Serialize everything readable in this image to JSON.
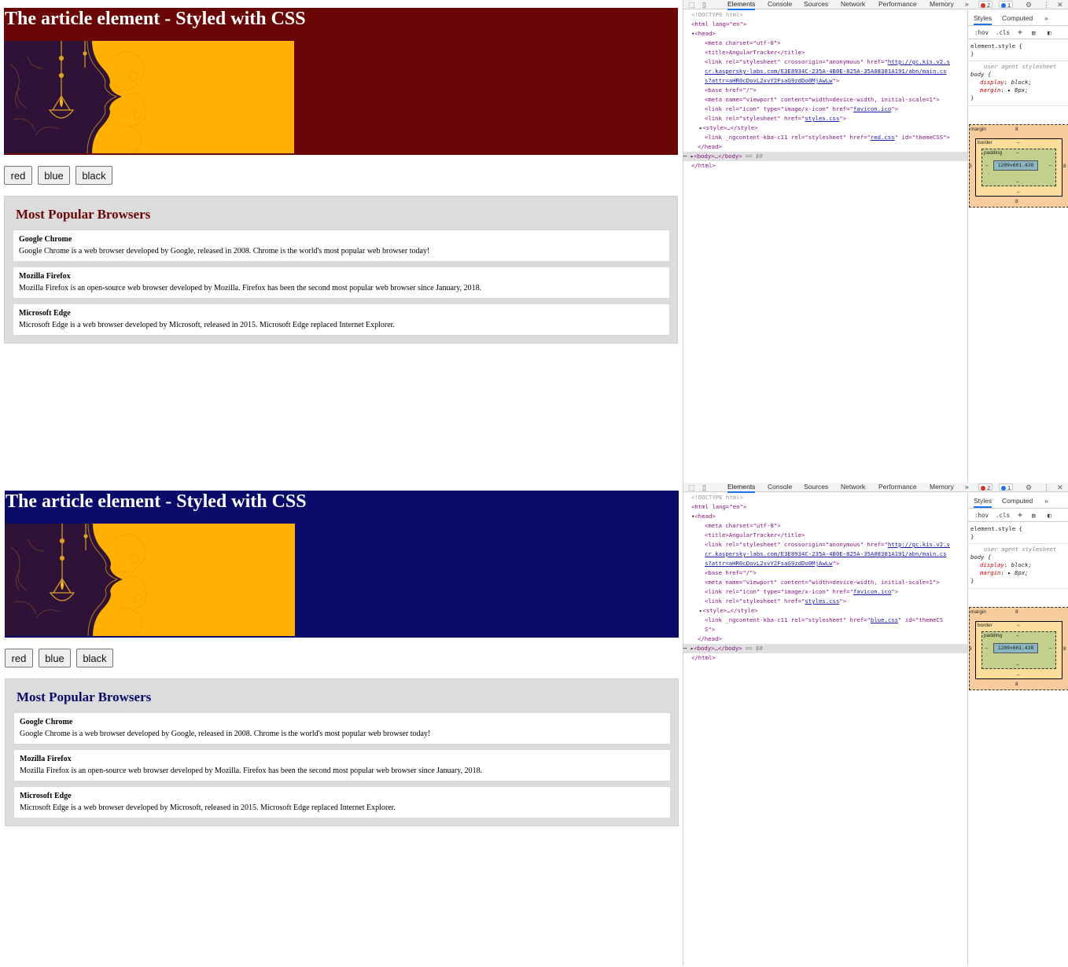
{
  "instances": [
    {
      "theme": "red",
      "banner_color": "#6b0606",
      "heading_color": "#6b0606",
      "theme_css_file": "red.css",
      "theme_css_tail": "\" id=\"themeCSS\">",
      "theme_css_tail2": ""
    },
    {
      "theme": "blue",
      "banner_color": "#0a0a6b",
      "heading_color": "#0a0a6b",
      "theme_css_file": "blue.css",
      "theme_css_tail": "\" id=\"themeCS",
      "theme_css_tail2": "S\">"
    }
  ],
  "page": {
    "title": "The article element - Styled with CSS",
    "theme_buttons": [
      "red",
      "blue",
      "black"
    ],
    "section_heading": "Most Popular Browsers",
    "browsers": [
      {
        "name": "Google Chrome",
        "description": "Google Chrome is a web browser developed by Google, released in 2008. Chrome is the world's most popular web browser today!"
      },
      {
        "name": "Mozilla Firefox",
        "description": "Mozilla Firefox is an open-source web browser developed by Mozilla. Firefox has been the second most popular web browser since January, 2018."
      },
      {
        "name": "Microsoft Edge",
        "description": "Microsoft Edge is a web browser developed by Microsoft, released in 2015. Microsoft Edge replaced Internet Explorer."
      }
    ]
  },
  "devtools": {
    "tabs": [
      "Elements",
      "Console",
      "Sources",
      "Network",
      "Performance",
      "Memory"
    ],
    "more_tabs": "»",
    "error_count": "2",
    "message_count": "1",
    "styles_tabs": [
      "Styles",
      "Computed"
    ],
    "filter_hov": ":hov",
    "filter_cls": ".cls",
    "colors": {
      "tag": "#881280",
      "attribute": "#994500",
      "value": "#1a1aa6",
      "error_dot": "#d93025",
      "message_dot": "#1a73e8",
      "margin_box": "#f9cc9d",
      "border_box": "#fddd9b",
      "padding_box": "#c3d08b",
      "content_box": "#8cb6c0"
    },
    "dom": {
      "doctype": "<!DOCTYPE html>",
      "html_open": "<html lang=\"en\">",
      "head_open": "<head>",
      "meta_charset": "<meta charset=\"utf-8\">",
      "title": "<title>AngularTracker</title>",
      "kasp_link_1": "<link rel=\"stylesheet\" crossorigin=\"anonymous\" href=\"",
      "kasp_url_1": "http://gc.kis.v2.s",
      "kasp_url_2": "cr.kaspersky-labs.com/E3E8934C-235A-4B0E-825A-35A08381A191/abn/main.cs",
      "kasp_url_3": "s?attr=aHR0cDovL2xvY2FsaG9zdDo0MjAwLw",
      "kasp_url_close": "\">",
      "base": "<base href=\"/\">",
      "meta_viewport": "<meta name=\"viewport\" content=\"width=device-width, initial-scale=1\">",
      "link_icon_pre": "<link rel=\"icon\" type=\"image/x-icon\" href=\"",
      "link_icon_href": "favicon.ico",
      "link_styles_pre": "<link rel=\"stylesheet\" href=\"",
      "link_styles_href": "styles.css",
      "link_close": "\">",
      "style_collapsed": "<style>…</style>",
      "theme_link_pre": "<link _ngcontent-kba-c11 rel=\"stylesheet\" href=\"",
      "head_close": "</head>",
      "body_collapsed": "<body>…</body>",
      "selected_marker": "== $0",
      "html_close": "</html>"
    },
    "styles": {
      "element_style": "element.style {",
      "close_brace": "}",
      "ua_label": "user agent stylesheet",
      "body_selector": "body {",
      "display_prop": "display",
      "display_val": "block;",
      "margin_prop": "margin",
      "margin_val": "8px;"
    },
    "box_model": {
      "margin_label": "margin",
      "border_label": "border",
      "padding_label": "padding",
      "content_size": "1209×601.438",
      "margin_value": "8",
      "dash": "–"
    }
  }
}
